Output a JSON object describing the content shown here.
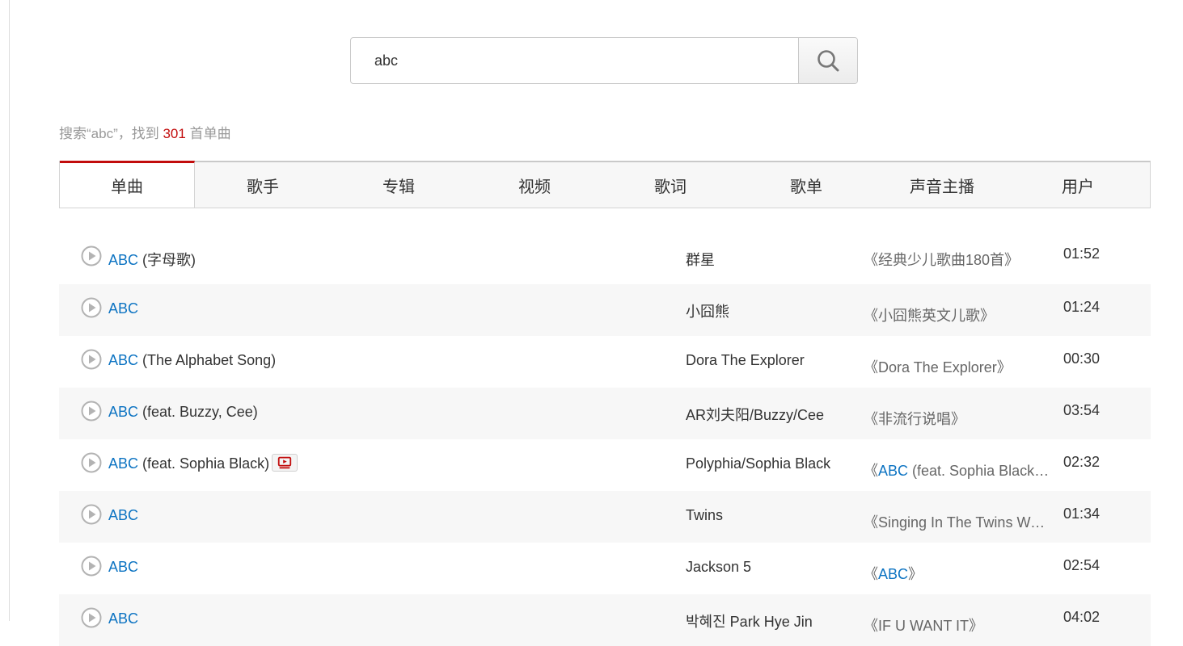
{
  "search": {
    "value": "abc"
  },
  "summary": {
    "prefix": "搜索“abc”，找到 ",
    "count": "301",
    "suffix": " 首单曲"
  },
  "tabs": [
    {
      "label": "单曲",
      "active": true
    },
    {
      "label": "歌手"
    },
    {
      "label": "专辑"
    },
    {
      "label": "视频"
    },
    {
      "label": "歌词"
    },
    {
      "label": "歌单"
    },
    {
      "label": "声音主播"
    },
    {
      "label": "用户"
    }
  ],
  "songs": [
    {
      "name": "ABC",
      "extra": " (字母歌)",
      "mv": false,
      "artist": "群星",
      "album_open": "《",
      "album": "经典少儿歌曲180首",
      "album_close": "》",
      "album_link": false,
      "duration": "01:52"
    },
    {
      "name": "ABC",
      "extra": "",
      "mv": false,
      "artist": "小囧熊",
      "album_open": "《",
      "album": "小囧熊英文儿歌",
      "album_close": "》",
      "album_link": false,
      "duration": "01:24"
    },
    {
      "name": "ABC",
      "extra": " (The Alphabet Song)",
      "mv": false,
      "artist": "Dora The Explorer",
      "album_open": "《",
      "album": "Dora The Explorer",
      "album_close": "》",
      "album_link": false,
      "duration": "00:30"
    },
    {
      "name": "ABC",
      "extra": " (feat. Buzzy, Cee)",
      "mv": false,
      "artist": "AR刘夫阳/Buzzy/Cee",
      "album_open": "《",
      "album": "非流行说唱",
      "album_close": "》",
      "album_link": false,
      "duration": "03:54"
    },
    {
      "name": "ABC",
      "extra": " (feat. Sophia Black)",
      "mv": true,
      "artist": "Polyphia/Sophia Black",
      "album_open": "《",
      "album": "ABC",
      "album_rest": " (feat. Sophia Black…",
      "album_close": "",
      "album_link": true,
      "duration": "02:32"
    },
    {
      "name": "ABC",
      "extra": "",
      "mv": false,
      "artist": "Twins",
      "album_open": "《",
      "album": "Singing In The Twins Wo…",
      "album_close": "",
      "album_link": false,
      "duration": "01:34"
    },
    {
      "name": "ABC",
      "extra": "",
      "mv": false,
      "artist": "Jackson 5",
      "album_open": "《",
      "album": "ABC",
      "album_close": "》",
      "album_link": true,
      "duration": "02:54"
    },
    {
      "name": "ABC",
      "extra": "",
      "mv": false,
      "artist": "박혜진 Park Hye Jin",
      "album_open": "《",
      "album": "IF U WANT IT",
      "album_close": "》",
      "album_link": false,
      "duration": "04:02"
    }
  ],
  "colors": {
    "accent": "#c20c0c",
    "link": "#0c73c2"
  }
}
